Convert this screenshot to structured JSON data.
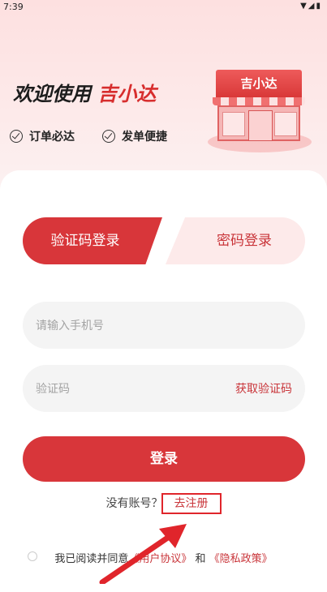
{
  "status": {
    "time": "7:39",
    "icons": "▼◢▮"
  },
  "welcome": {
    "prefix": "欢迎使用",
    "brand": "吉小达"
  },
  "features": [
    "订单必达",
    "发单便捷"
  ],
  "store_sign": "吉小达",
  "tabs": {
    "active": "验证码登录",
    "inactive": "密码登录"
  },
  "phone": {
    "placeholder": "请输入手机号"
  },
  "code": {
    "placeholder": "验证码",
    "get_code": "获取验证码"
  },
  "login_button": "登录",
  "register": {
    "question": "没有账号？",
    "link": "去注册"
  },
  "agreement": {
    "prefix": "我已阅读并同意",
    "user_agreement": "《用户协议》",
    "and": "和",
    "privacy": "《隐私政策》"
  },
  "colors": {
    "primary": "#d8363a",
    "accent_text": "#c9353a",
    "highlight_box": "#e0252b"
  }
}
